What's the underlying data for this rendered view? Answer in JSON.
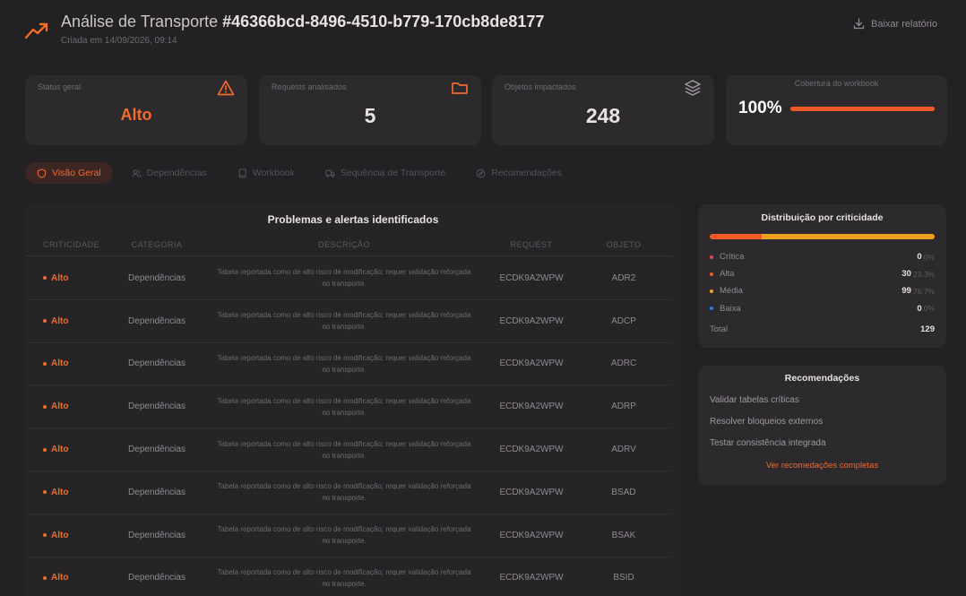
{
  "header": {
    "title_prefix": "Análise de Transporte ",
    "transport_id": "#46366bcd-8496-4510-b779-170cb8de8177",
    "created": "Criada em 14/09/2026, 09:14",
    "download_label": "Baixar relatório"
  },
  "stats": {
    "status": {
      "label": "Status geral",
      "value": "Alto",
      "icon": "warning-icon"
    },
    "requests": {
      "label": "Requests analisados",
      "value": "5",
      "icon": "folder-icon"
    },
    "objects": {
      "label": "Objetos impactados",
      "value": "248",
      "icon": "layers-icon"
    },
    "coverage": {
      "label": "Cobertura do workbook",
      "value": "100%",
      "percent": 100
    }
  },
  "tabs": [
    {
      "label": "Visão Geral",
      "icon": "shield-icon",
      "active": true
    },
    {
      "label": "Dependências",
      "icon": "users-icon",
      "active": false
    },
    {
      "label": "Workbook",
      "icon": "book-icon",
      "active": false
    },
    {
      "label": "Sequência de Transporte",
      "icon": "truck-icon",
      "active": false
    },
    {
      "label": "Recomendações",
      "icon": "compass-icon",
      "active": false
    }
  ],
  "problems": {
    "title": "Problemas e alertas identificados",
    "columns": [
      "CRITICIDADE",
      "CATEGORIA",
      "DESCRIÇÃO",
      "REQUEST",
      "OBJETO"
    ],
    "rows": [
      {
        "criticidade": "Alto",
        "categoria": "Dependências",
        "descricao": "Tabela reportada como de alto risco de modificação; requer validação reforçada no transporte.",
        "request": "ECDK9A2WPW",
        "objeto": "ADR2"
      },
      {
        "criticidade": "Alto",
        "categoria": "Dependências",
        "descricao": "Tabela reportada como de alto risco de modificação; requer validação reforçada no transporte.",
        "request": "ECDK9A2WPW",
        "objeto": "ADCP"
      },
      {
        "criticidade": "Alto",
        "categoria": "Dependências",
        "descricao": "Tabela reportada como de alto risco de modificação; requer validação reforçada no transporte.",
        "request": "ECDK9A2WPW",
        "objeto": "ADRC"
      },
      {
        "criticidade": "Alto",
        "categoria": "Dependências",
        "descricao": "Tabela reportada como de alto risco de modificação; requer validação reforçada no transporte.",
        "request": "ECDK9A2WPW",
        "objeto": "ADRP"
      },
      {
        "criticidade": "Alto",
        "categoria": "Dependências",
        "descricao": "Tabela reportada como de alto risco de modificação; requer validação reforçada no transporte.",
        "request": "ECDK9A2WPW",
        "objeto": "ADRV"
      },
      {
        "criticidade": "Alto",
        "categoria": "Dependências",
        "descricao": "Tabela reportada como de alto risco de modificação; requer validação reforçada no transporte.",
        "request": "ECDK9A2WPW",
        "objeto": "BSAD"
      },
      {
        "criticidade": "Alto",
        "categoria": "Dependências",
        "descricao": "Tabela reportada como de alto risco de modificação; requer validação reforçada no transporte.",
        "request": "ECDK9A2WPW",
        "objeto": "BSAK"
      },
      {
        "criticidade": "Alto",
        "categoria": "Dependências",
        "descricao": "Tabela reportada como de alto risco de modificação; requer validação reforçada no transporte.",
        "request": "ECDK9A2WPW",
        "objeto": "BSID"
      }
    ]
  },
  "distribution": {
    "title": "Distribuição por criticidade",
    "items": [
      {
        "name": "Crítica",
        "count": "0",
        "pct": "0%",
        "fraction": 0,
        "color": "#e5484d"
      },
      {
        "name": "Alta",
        "count": "30",
        "pct": "23.3%",
        "fraction": 0.233,
        "color": "#f05a28"
      },
      {
        "name": "Média",
        "count": "99",
        "pct": "76.7%",
        "fraction": 0.767,
        "color": "#f0a020"
      },
      {
        "name": "Baixa",
        "count": "0",
        "pct": "0%",
        "fraction": 0,
        "color": "#2f7fe0"
      }
    ],
    "total_label": "Total",
    "total_value": "129"
  },
  "recommendations": {
    "title": "Recomendações",
    "items": [
      "Validar tabelas críticas",
      "Resolver bloqueios externos",
      "Testar consistência integrada"
    ],
    "link": "Ver recomedações completas"
  },
  "colors": {
    "accent": "#f36a2d",
    "background": "#232124",
    "card": "#2c2a2d"
  }
}
